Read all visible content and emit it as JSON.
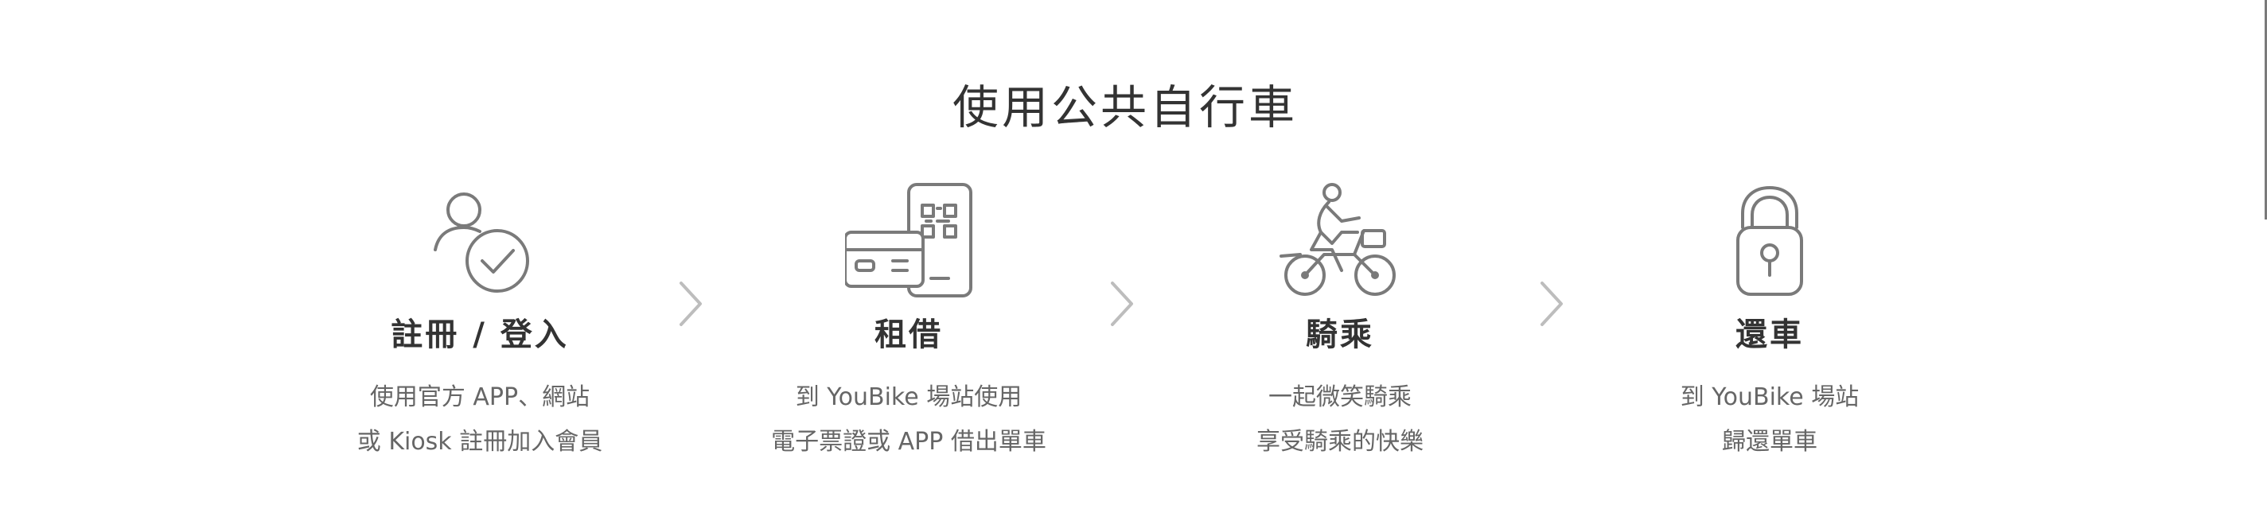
{
  "section": {
    "title": "使用公共自行車"
  },
  "steps": [
    {
      "icon": "user-check-icon",
      "title": "註冊 / 登入",
      "desc_line1": "使用官方 APP、網站",
      "desc_line2": "或 Kiosk 註冊加入會員"
    },
    {
      "icon": "card-phone-qr-icon",
      "title": "租借",
      "desc_line1": "到 YouBike 場站使用",
      "desc_line2": "電子票證或 APP 借出單車"
    },
    {
      "icon": "bicycle-rider-icon",
      "title": "騎乘",
      "desc_line1": "一起微笑騎乘",
      "desc_line2": "享受騎乘的快樂"
    },
    {
      "icon": "padlock-icon",
      "title": "還車",
      "desc_line1": "到 YouBike 場站",
      "desc_line2": "歸還單車"
    }
  ],
  "arrows": [
    "chevron-right-icon",
    "chevron-right-icon",
    "chevron-right-icon"
  ],
  "colors": {
    "text": "#333333",
    "muted": "#666666",
    "icon": "#7a7a7a",
    "arrow": "#bdbdbd"
  }
}
